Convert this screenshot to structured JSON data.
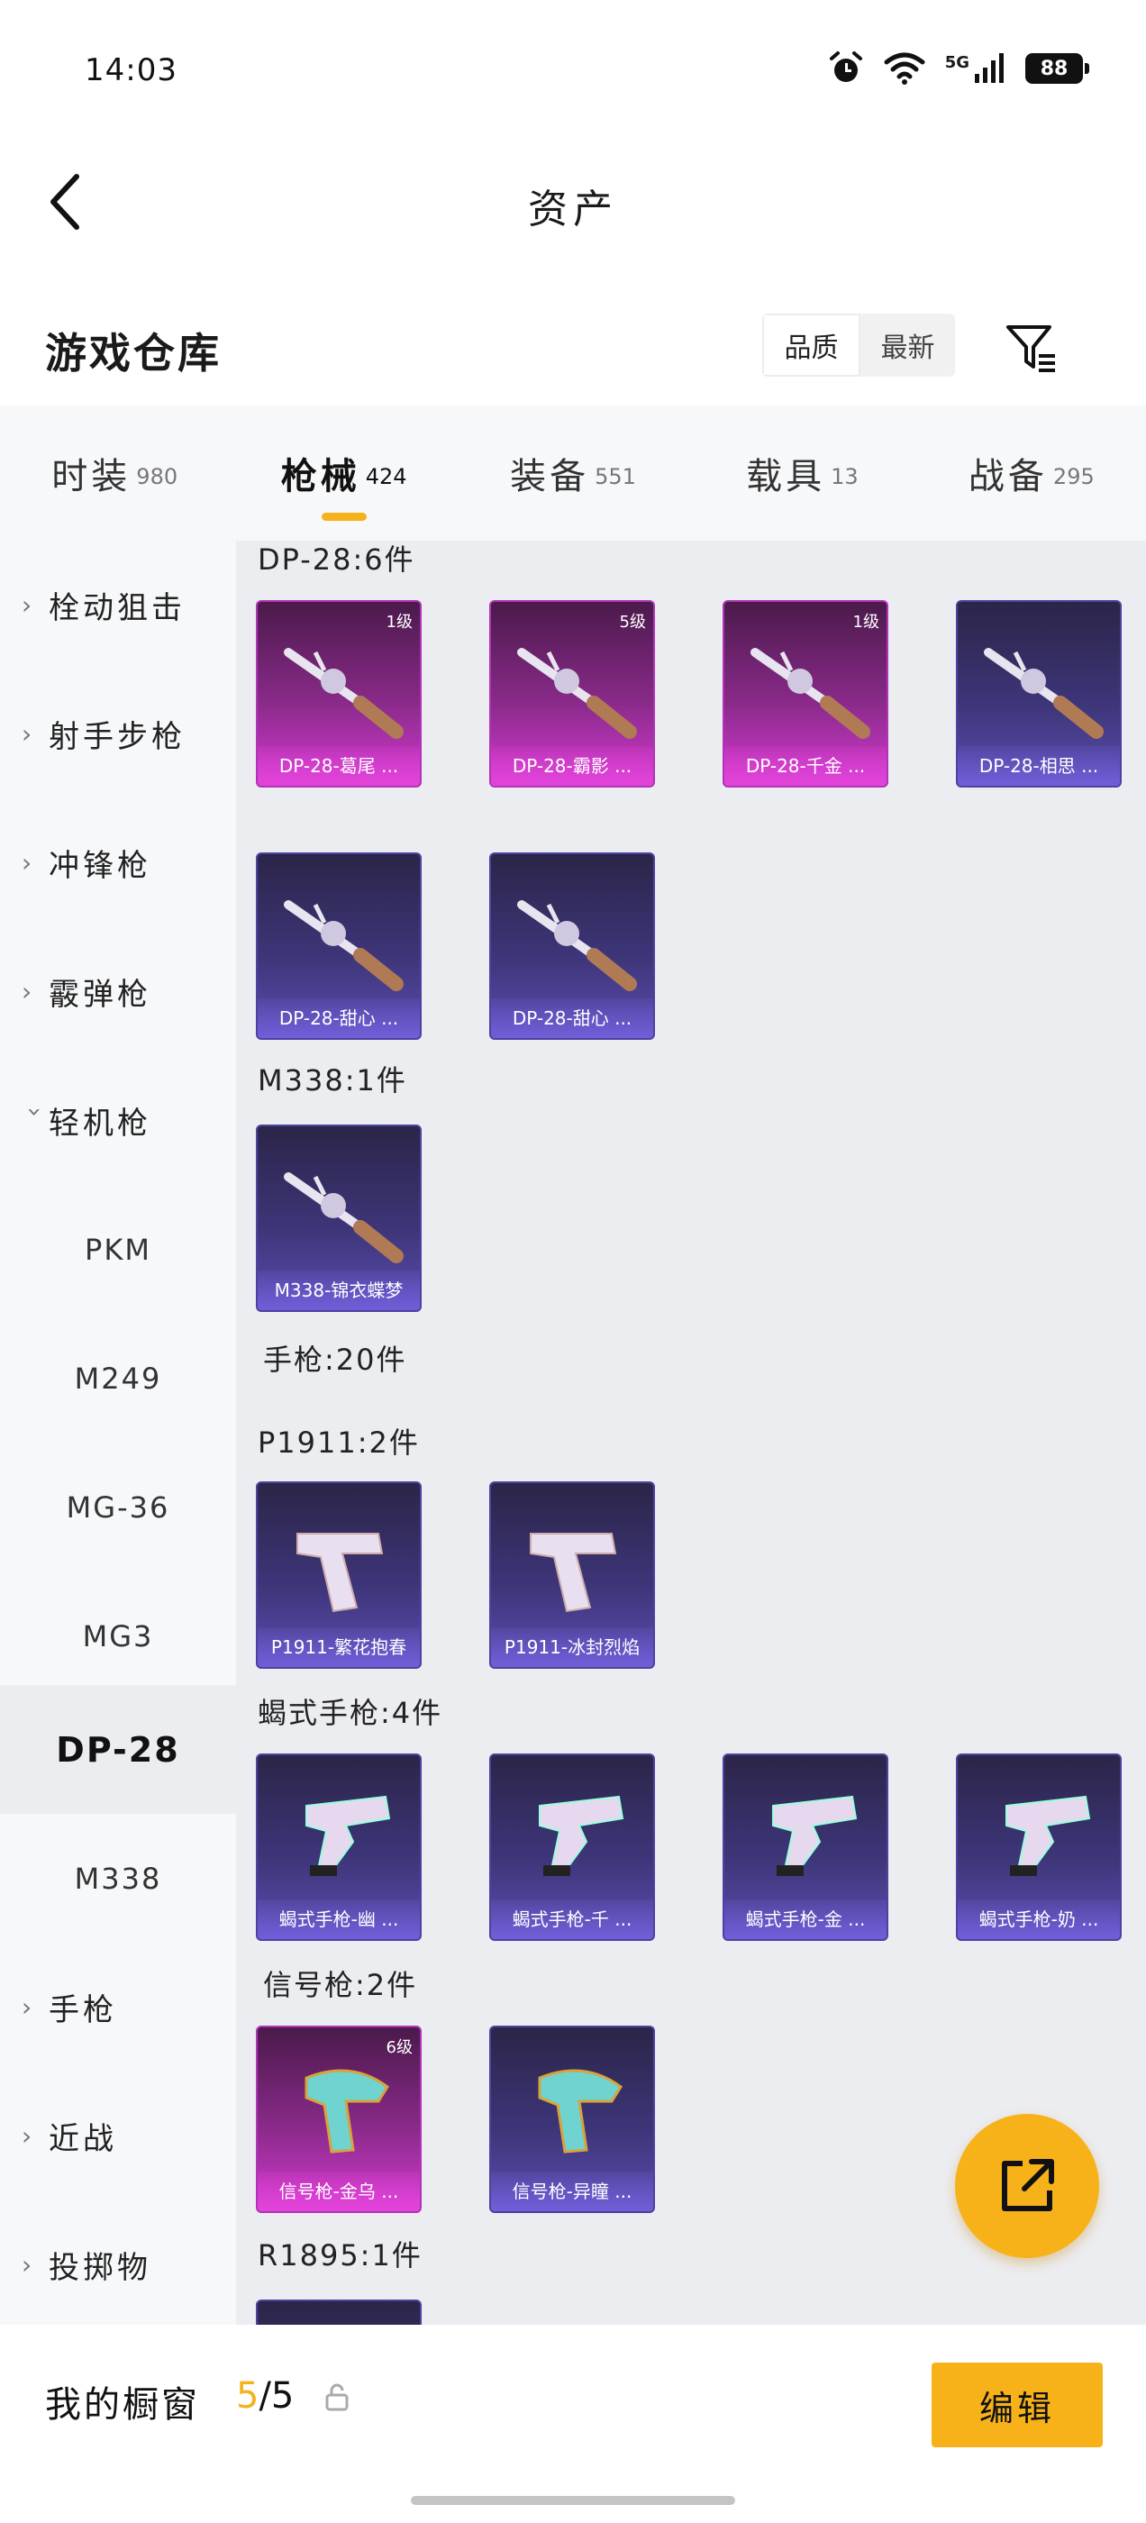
{
  "status": {
    "time": "14:03",
    "network": "5G",
    "battery": "88"
  },
  "header": {
    "title": "资产"
  },
  "warehouse": {
    "title": "游戏仓库",
    "sort": [
      "品质",
      "最新"
    ]
  },
  "tabs": [
    {
      "label": "时装",
      "count": "980"
    },
    {
      "label": "枪械",
      "count": "424"
    },
    {
      "label": "装备",
      "count": "551"
    },
    {
      "label": "载具",
      "count": "13"
    },
    {
      "label": "战备",
      "count": "295"
    }
  ],
  "sidebar": [
    {
      "label": "栓动狙击",
      "kind": "parent"
    },
    {
      "label": "射手步枪",
      "kind": "parent"
    },
    {
      "label": "冲锋枪",
      "kind": "parent"
    },
    {
      "label": "霰弹枪",
      "kind": "parent"
    },
    {
      "label": "轻机枪",
      "kind": "parent-open"
    },
    {
      "label": "PKM",
      "kind": "child"
    },
    {
      "label": "M249",
      "kind": "child"
    },
    {
      "label": "MG-36",
      "kind": "child"
    },
    {
      "label": "MG3",
      "kind": "child"
    },
    {
      "label": "DP-28",
      "kind": "child-selected"
    },
    {
      "label": "M338",
      "kind": "child"
    },
    {
      "label": "手枪",
      "kind": "parent"
    },
    {
      "label": "近战",
      "kind": "parent"
    },
    {
      "label": "投掷物",
      "kind": "parent"
    }
  ],
  "content": {
    "sections": [
      {
        "label": "DP-28:6件"
      },
      {
        "label": "M338:1件"
      },
      {
        "label": "手枪:20件"
      },
      {
        "label": "P1911:2件"
      },
      {
        "label": "蝎式手枪:4件"
      },
      {
        "label": "信号枪:2件"
      },
      {
        "label": "R1895:1件"
      }
    ],
    "cards": [
      {
        "name": "DP-28-葛尾 ...",
        "tier": "1级",
        "rarity": "pink",
        "icon": "lmg-icon"
      },
      {
        "name": "DP-28-霸影 ...",
        "tier": "5级",
        "rarity": "pink",
        "icon": "lmg-icon"
      },
      {
        "name": "DP-28-千金 ...",
        "tier": "1级",
        "rarity": "pink",
        "icon": "lmg-icon"
      },
      {
        "name": "DP-28-相思 ...",
        "tier": "",
        "rarity": "purple",
        "icon": "lmg-icon"
      },
      {
        "name": "DP-28-甜心 ...",
        "tier": "",
        "rarity": "purple",
        "icon": "lmg-icon"
      },
      {
        "name": "DP-28-甜心 ...",
        "tier": "",
        "rarity": "purple",
        "icon": "lmg-icon"
      },
      {
        "name": "M338-锦衣蝶梦",
        "tier": "",
        "rarity": "purple",
        "icon": "lmg-icon"
      },
      {
        "name": "P1911-繁花抱春",
        "tier": "",
        "rarity": "purple",
        "icon": "pistol-icon"
      },
      {
        "name": "P1911-冰封烈焰",
        "tier": "",
        "rarity": "purple",
        "icon": "pistol-icon"
      },
      {
        "name": "蝎式手枪-幽 ...",
        "tier": "",
        "rarity": "purple",
        "icon": "smg-pistol-icon"
      },
      {
        "name": "蝎式手枪-千 ...",
        "tier": "",
        "rarity": "purple",
        "icon": "smg-pistol-icon"
      },
      {
        "name": "蝎式手枪-金 ...",
        "tier": "",
        "rarity": "purple",
        "icon": "smg-pistol-icon"
      },
      {
        "name": "蝎式手枪-奶 ...",
        "tier": "",
        "rarity": "purple",
        "icon": "smg-pistol-icon"
      },
      {
        "name": "信号枪-金乌 ...",
        "tier": "6级",
        "rarity": "pink",
        "icon": "flare-gun-icon"
      },
      {
        "name": "信号枪-异瞳 ...",
        "tier": "",
        "rarity": "purple",
        "icon": "flare-gun-icon"
      },
      {
        "name": "",
        "tier": "",
        "rarity": "purple",
        "icon": "revolver-icon"
      }
    ]
  },
  "bottom": {
    "window_label": "我的橱窗",
    "count_current": "5",
    "count_total": "/5",
    "edit_label": "编辑"
  },
  "colors": {
    "accent": "#f7b219",
    "epic": "#5a4cb0",
    "legendary": "#d43ad0"
  }
}
